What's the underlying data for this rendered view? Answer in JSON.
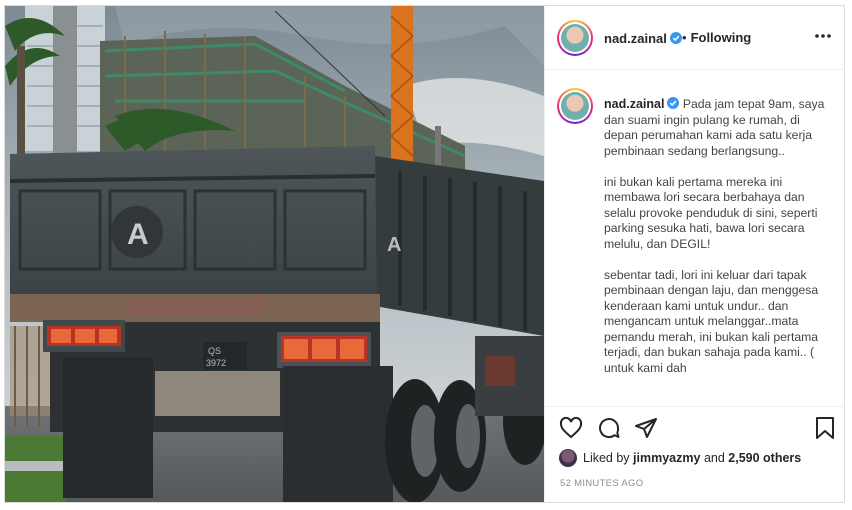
{
  "post": {
    "username": "nad.zainal",
    "follow_status": "Following",
    "caption": [
      "Pada jam tepat 9am, saya dan suami ingin pulang ke rumah, di depan perumahan kami ada satu kerja pembinaan sedang berlangsung..",
      "ini bukan kali pertama mereka ini membawa lori secara berbahaya dan selalu provoke penduduk di sini, seperti parking sesuka hati, bawa lori secara melulu, dan DEGIL!",
      "sebentar tadi, lori ini keluar dari tapak pembinaan dengan laju, dan menggesa kenderaan kami untuk undur.. dan mengancam untuk melanggar..mata pemandu merah, ini bukan kali pertama terjadi, dan bukan sahaja pada kami.. ( untuk kami dah"
    ],
    "liked_by_prefix": "Liked by",
    "liked_by_user": "jimmyazmy",
    "liked_by_join": "and",
    "liked_by_others": "2,590 others",
    "timestamp": "52 MINUTES AGO"
  },
  "photo": {
    "truck_plate": "QS 3972 V",
    "truck_mark": "A"
  },
  "icons": {
    "verified": "verified-badge-icon",
    "more": "more-options-icon",
    "like": "heart-icon",
    "comment": "comment-icon",
    "share": "share-icon",
    "save": "bookmark-icon"
  },
  "colors": {
    "verified_blue": "#3897f0",
    "secondary_text": "#8e8e8e",
    "border": "#dbdbdb"
  }
}
